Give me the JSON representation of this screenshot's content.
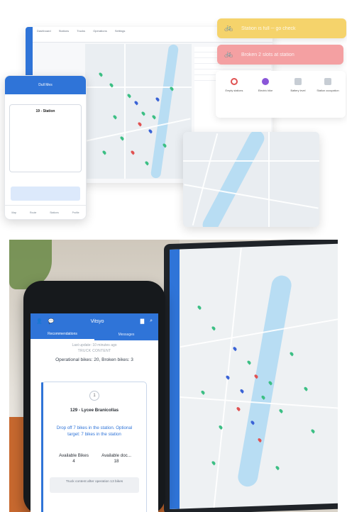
{
  "top_collage": {
    "desktop_window": {
      "toolbar_items": [
        "Dashboard",
        "Stations",
        "Trucks",
        "Operations",
        "Settings"
      ]
    },
    "mini_phone": {
      "header_title": "Dull Mes",
      "card_title": "19 - Station",
      "tab_items": [
        "Map",
        "Route",
        "Stations",
        "Profile"
      ]
    },
    "notifications": [
      {
        "id": "yellow",
        "text": "Station is full ─ go check",
        "icon": "bike-icon",
        "color": "#f5d36b"
      },
      {
        "id": "red",
        "text": "Broken 2 slots at station",
        "icon": "bike-icon",
        "color": "#f4a0a2"
      }
    ],
    "legend": {
      "items": [
        {
          "label": "Empty stations",
          "color": "#e05252"
        },
        {
          "label": "Electric bike",
          "color": "#8a56d8"
        },
        {
          "label": "Battery level",
          "color": "#9aa3ad"
        },
        {
          "label": "Station occupation",
          "color": "#9aa3ad"
        }
      ]
    }
  },
  "photo_phone": {
    "header_title": "Vitsyo",
    "tabs": [
      "Recommendations",
      "Messages"
    ],
    "active_tab": "Recommendations",
    "subtitle": "Last update: 10 minutes ago",
    "caption": "TRUCK CONTENT",
    "bikes_summary": "Operational bikes: 20, Broken bikes: 3",
    "station": {
      "step": "1",
      "title": "129 - Lycee Branicollas",
      "instruction": "Drop off 7 bikes in the station. Optional target: 7 bikes in the station",
      "available_bikes_label": "Available Bikes",
      "available_bikes_value": "4",
      "available_docks_label": "Available doc...",
      "available_docks_value": "18",
      "truck_button": "Truck content after operation 13 bikes"
    }
  },
  "colors": {
    "brand_blue": "#2f74d8",
    "pin_green": "#3cbf84",
    "pin_blue": "#3a63d6",
    "pin_red": "#e05252"
  }
}
